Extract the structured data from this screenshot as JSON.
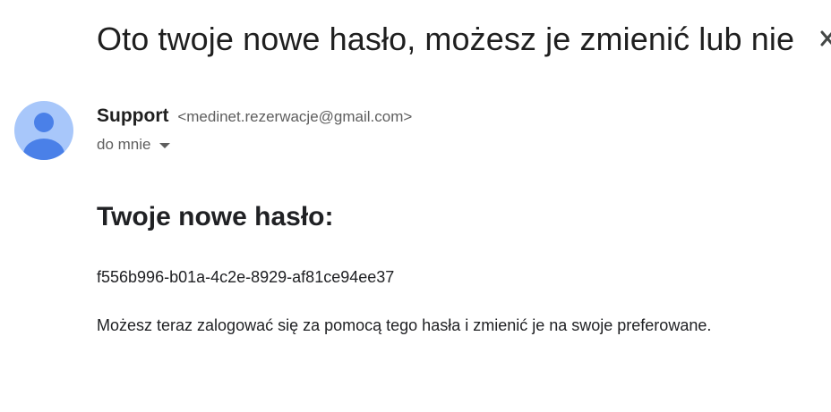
{
  "email": {
    "subject": "Oto twoje nowe hasło, możesz je zmienić lub nie",
    "sender": {
      "name": "Support",
      "address": "<medinet.rezerwacje@gmail.com>"
    },
    "recipient_label": "do mnie",
    "body": {
      "heading": "Twoje nowe hasło:",
      "password": "f556b996-b01a-4c2e-8929-af81ce94ee37",
      "message": "Możesz teraz zalogować się za pomocą tego hasła i zmienić je na swoje preferowane."
    }
  },
  "colors": {
    "avatar_bg": "#a8c7fa",
    "avatar_figure": "#4a80e8",
    "secondary_text": "#5e5e5e"
  },
  "icons": {
    "avatar": "person-icon",
    "recipient_details": "chevron-down-icon",
    "subject_action": "close-icon"
  }
}
